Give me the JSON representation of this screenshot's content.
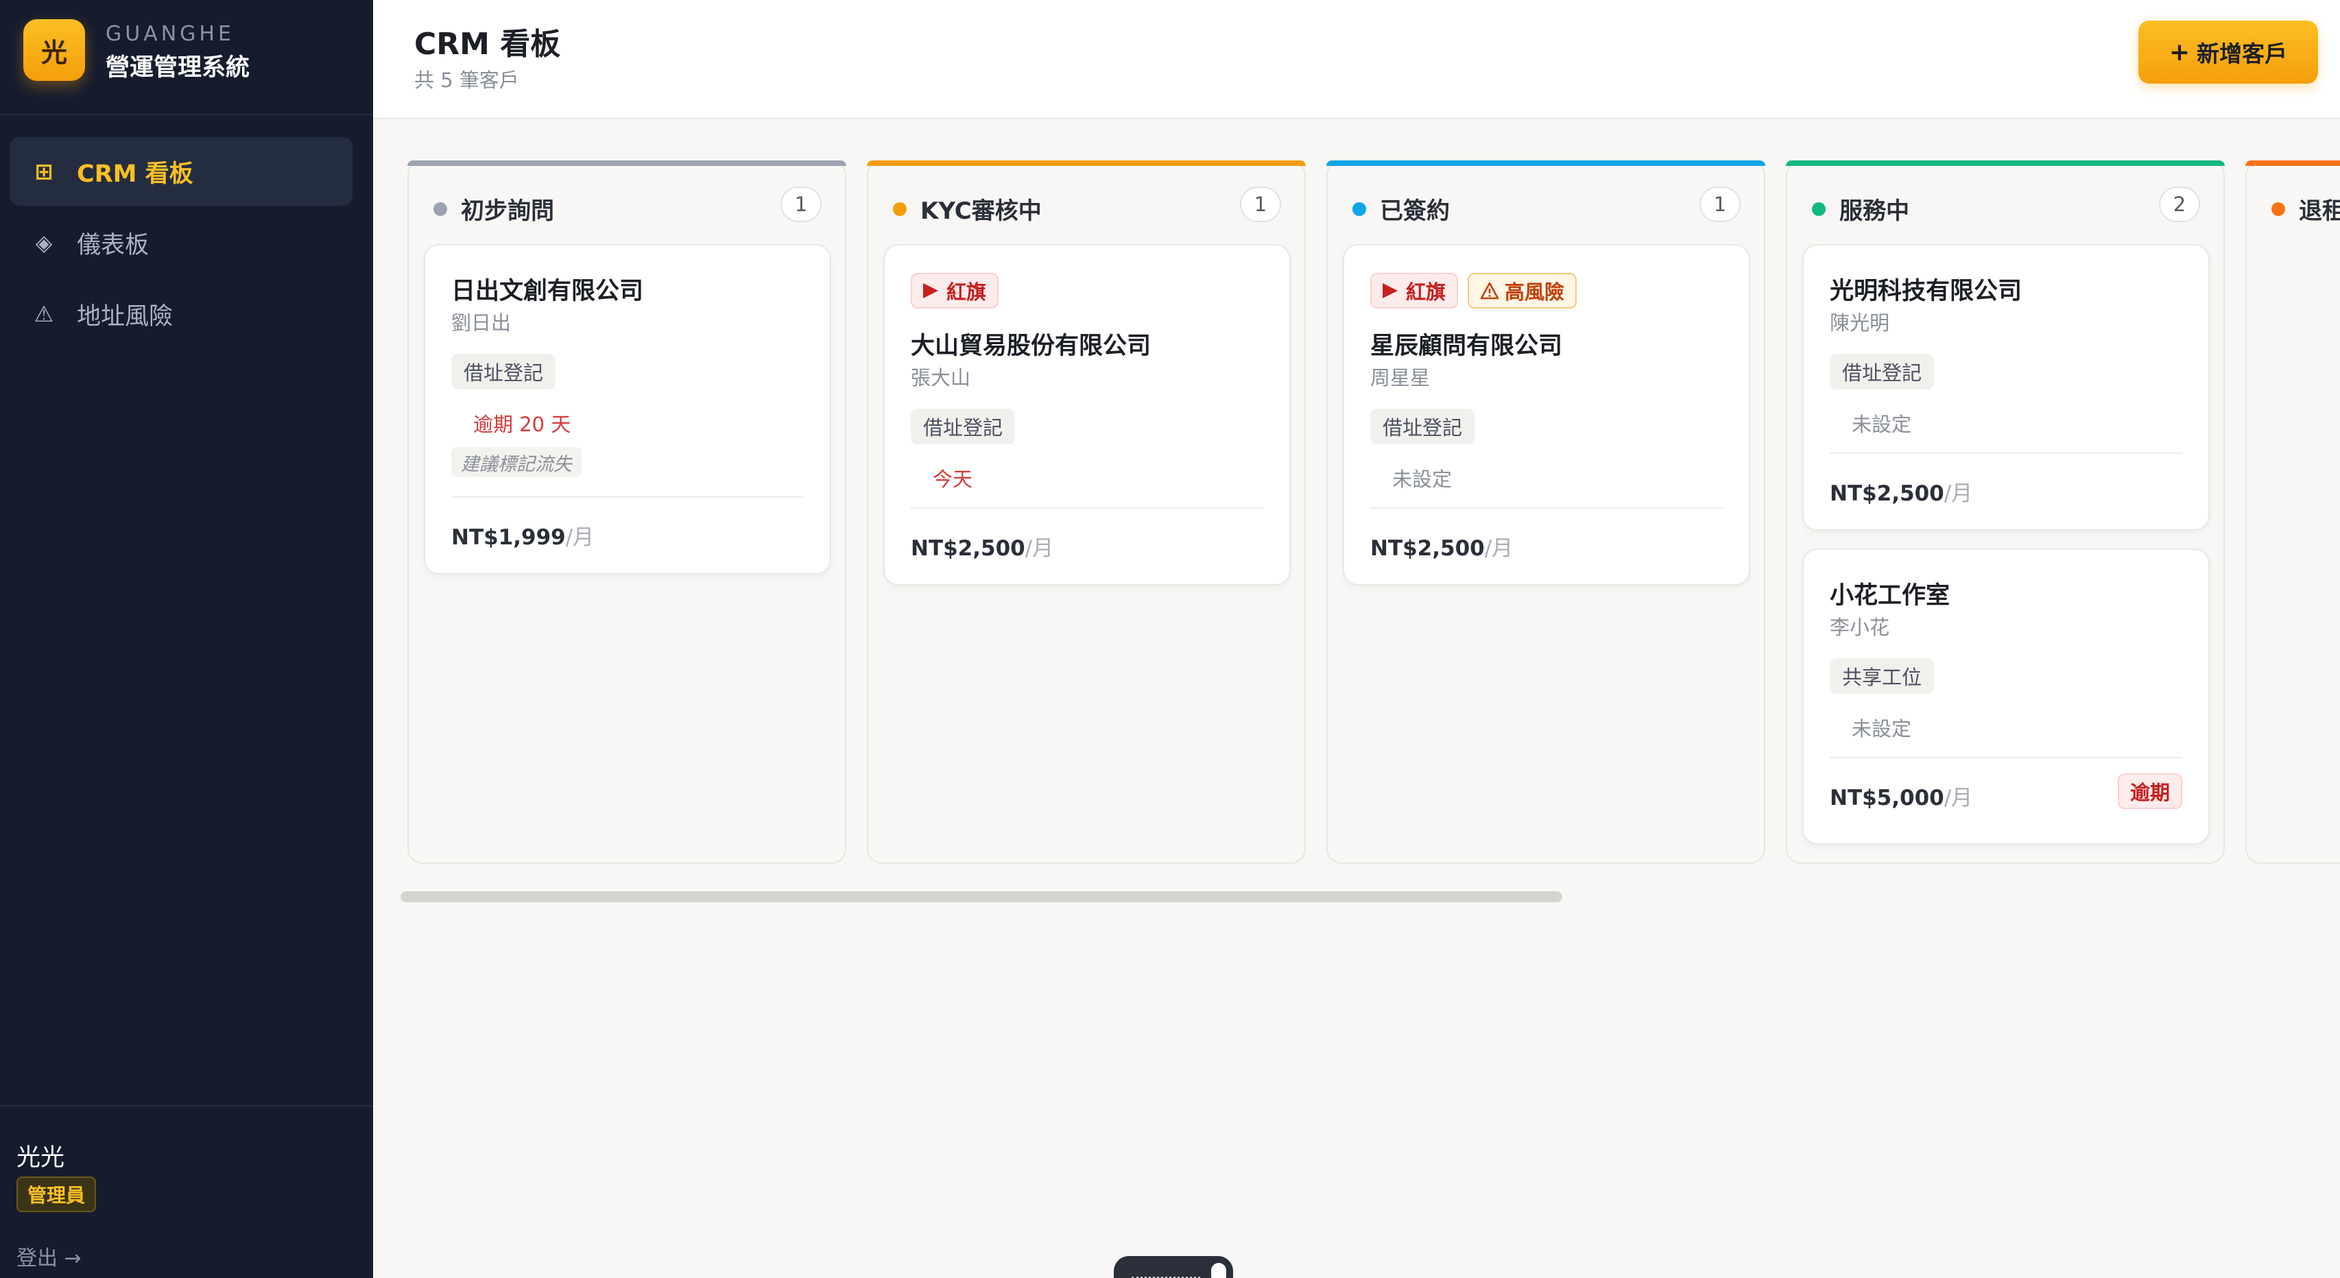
{
  "brand": {
    "logo_char": "光",
    "en": "GUANGHE",
    "name": "營運管理系統"
  },
  "nav": [
    {
      "label": "CRM 看板",
      "icon": "grid-icon",
      "glyph": "⊞",
      "active": true
    },
    {
      "label": "儀表板",
      "icon": "diamond-icon",
      "glyph": "◈",
      "active": false
    },
    {
      "label": "地址風險",
      "icon": "warning-icon",
      "glyph": "⚠",
      "active": false
    }
  ],
  "user": {
    "name": "光光",
    "role": "管理員",
    "logout": "登出 →"
  },
  "header": {
    "title": "CRM 看板",
    "subtitle": "共 5 筆客戶",
    "add_button": "新增客戶",
    "add_icon": "+"
  },
  "columns": [
    {
      "title": "初步詢問",
      "count": "1",
      "color": "#9ca3af"
    },
    {
      "title": "KYC審核中",
      "count": "1",
      "color": "#f59e0b"
    },
    {
      "title": "已簽約",
      "count": "1",
      "color": "#0ea5e9"
    },
    {
      "title": "服務中",
      "count": "2",
      "color": "#10b981"
    },
    {
      "title": "退租",
      "count": "",
      "color": "#f97316"
    }
  ],
  "cards": [
    {
      "company": "日出文創有限公司",
      "person": "劉日出",
      "tag": "借址登記",
      "due": "逾期 20 天",
      "hint": "建議標記流失",
      "price": "NT$1,999",
      "unit": "/月"
    },
    {
      "flag": "紅旗",
      "company": "大山貿易股份有限公司",
      "person": "張大山",
      "tag": "借址登記",
      "due": "今天",
      "price": "NT$2,500",
      "unit": "/月"
    },
    {
      "flag": "紅旗",
      "risk": "高風險",
      "company": "星辰顧問有限公司",
      "person": "周星星",
      "tag": "借址登記",
      "due": "未設定",
      "price": "NT$2,500",
      "unit": "/月"
    },
    {
      "company": "光明科技有限公司",
      "person": "陳光明",
      "tag": "借址登記",
      "due": "未設定",
      "price": "NT$2,500",
      "unit": "/月"
    },
    {
      "company": "小花工作室",
      "person": "李小花",
      "tag": "共享工位",
      "due": "未設定",
      "price": "NT$5,000",
      "unit": "/月",
      "badge": "逾期"
    }
  ],
  "colors": {
    "sidebar": "#151c2e",
    "accent": "#fbbf24",
    "danger": "#c81e1e"
  }
}
